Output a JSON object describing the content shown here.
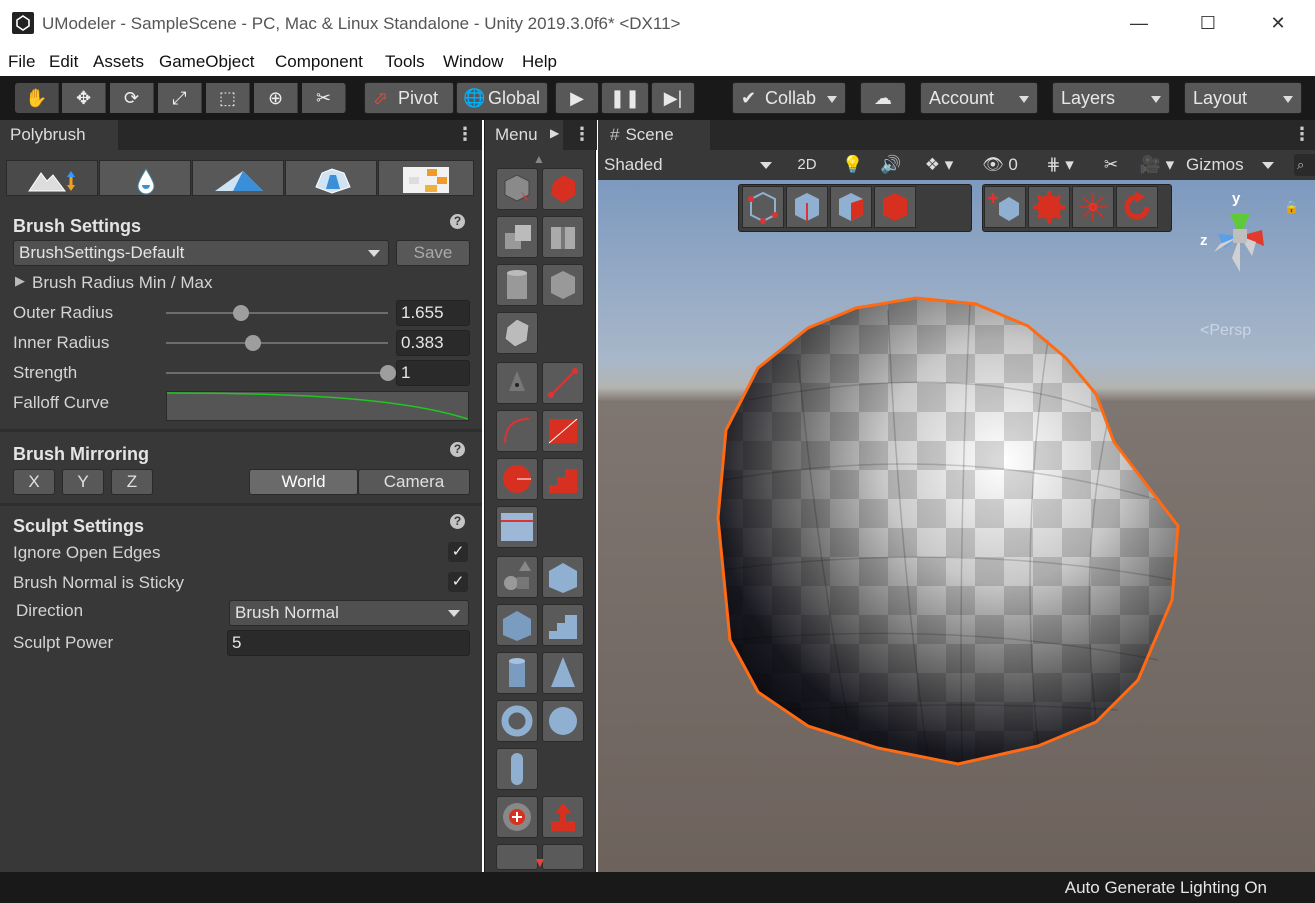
{
  "window": {
    "title": "UModeler - SampleScene - PC, Mac & Linux Standalone - Unity 2019.3.0f6* <DX11>",
    "minimize": "—",
    "maximize": "☐",
    "close": "✕"
  },
  "menubar": [
    "File",
    "Edit",
    "Assets",
    "GameObject",
    "Component",
    "Tools",
    "Window",
    "Help"
  ],
  "toolbar": {
    "tools": [
      "hand-tool",
      "move-tool",
      "rotate-tool",
      "scale-tool",
      "rect-tool",
      "transform-tool",
      "custom-tool"
    ],
    "pivot": "Pivot",
    "global": "Global",
    "collab": "Collab",
    "account": "Account",
    "layers": "Layers",
    "layout": "Layout"
  },
  "polybrush": {
    "tab": "Polybrush",
    "modes": [
      "sculpt-mode",
      "smooth-mode",
      "paint-mode",
      "prefab-mode",
      "texture-mode"
    ],
    "brush_settings": {
      "title": "Brush Settings",
      "preset": "BrushSettings-Default",
      "save": "Save",
      "radius_group": "Brush Radius Min / Max",
      "outer_radius_label": "Outer Radius",
      "outer_radius": "1.655",
      "outer_frac": 0.34,
      "inner_radius_label": "Inner Radius",
      "inner_radius": "0.383",
      "inner_frac": 0.39,
      "strength_label": "Strength",
      "strength": "1",
      "strength_frac": 1.0,
      "falloff_label": "Falloff Curve"
    },
    "mirroring": {
      "title": "Brush Mirroring",
      "x": "X",
      "y": "Y",
      "z": "Z",
      "world": "World",
      "camera": "Camera"
    },
    "sculpt": {
      "title": "Sculpt Settings",
      "ignore_open_edges": "Ignore Open Edges",
      "sticky": "Brush Normal is Sticky",
      "direction_label": "Direction",
      "direction": "Brush Normal",
      "power_label": "Sculpt Power",
      "power": "5"
    }
  },
  "menu_panel": {
    "tab": "Menu"
  },
  "scene": {
    "tab": "Scene",
    "shading": "Shaded",
    "mode2d": "2D",
    "hidden_count": "0",
    "gizmos": "Gizmos",
    "persp": "<Persp",
    "gizmo_y": "y",
    "gizmo_z": "z"
  },
  "status": "Auto Generate Lighting On",
  "colors": {
    "accent": "#ff6a13",
    "unity_dark": "#383838",
    "selection": "#e07020"
  }
}
